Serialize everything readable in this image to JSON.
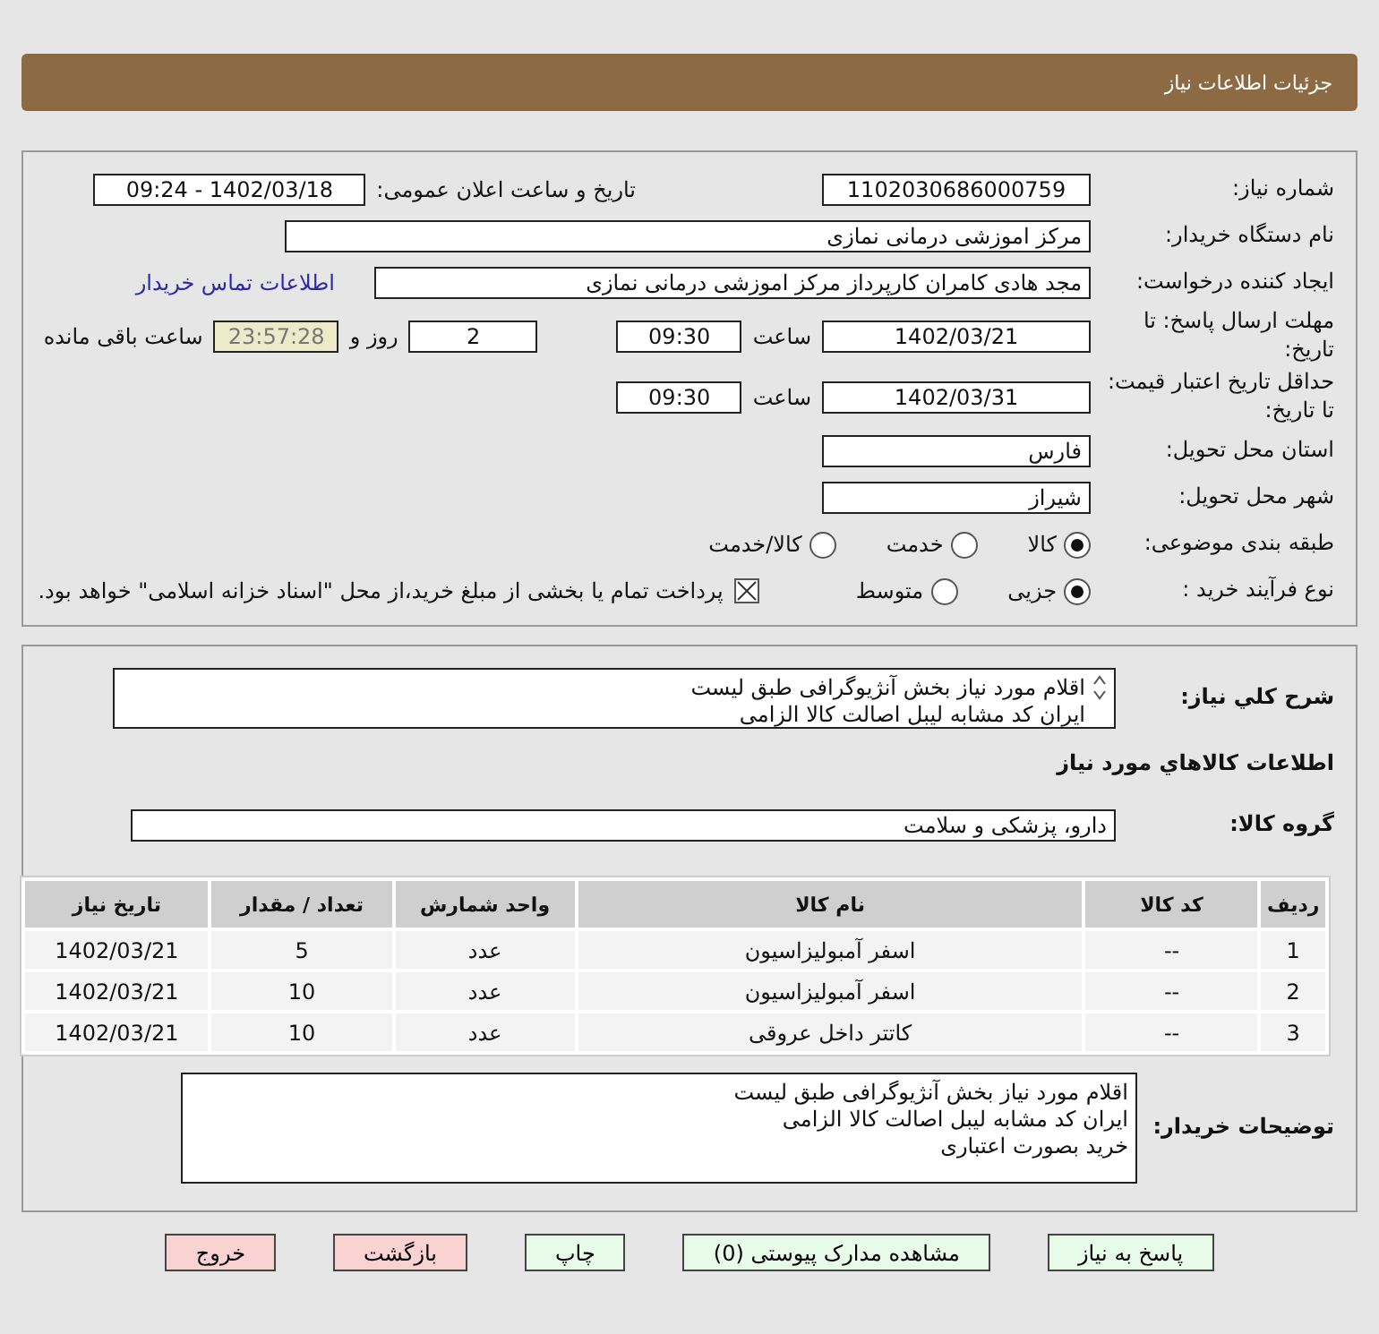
{
  "header": {
    "title": "جزئیات اطلاعات نیاز"
  },
  "details": {
    "need_number": {
      "label": "شماره نیاز:",
      "value": "1102030686000759"
    },
    "announce": {
      "label": "تاریخ و ساعت اعلان عمومی:",
      "value": "1402/03/18 - 09:24"
    },
    "buyer_org": {
      "label": "نام دستگاه خریدار:",
      "value": "مرکز اموزشی درمانی نمازی"
    },
    "requester": {
      "label": "ایجاد کننده درخواست:",
      "value": "مجد هادی کامران کارپرداز مرکز اموزشی درمانی نمازی",
      "link": "اطلاعات تماس خریدار"
    },
    "deadline": {
      "label": "مهلت ارسال پاسخ: تا تاریخ:",
      "date": "1402/03/21",
      "time_label": "ساعت",
      "time": "09:30",
      "days": "2",
      "days_label": "روز و",
      "remaining": "23:57:28",
      "remaining_label": "ساعت باقی مانده"
    },
    "validity": {
      "label": "حداقل تاریخ اعتبار قیمت: تا تاریخ:",
      "date": "1402/03/31",
      "time_label": "ساعت",
      "time": "09:30"
    },
    "province": {
      "label": "استان محل تحویل:",
      "value": "فارس"
    },
    "city": {
      "label": "شهر محل تحویل:",
      "value": "شیراز"
    },
    "category": {
      "label": "طبقه بندی موضوعی:",
      "options": [
        {
          "label": "کالا",
          "selected": true
        },
        {
          "label": "خدمت",
          "selected": false
        },
        {
          "label": "کالا/خدمت",
          "selected": false
        }
      ]
    },
    "process": {
      "label": "نوع فرآیند خرید :",
      "options": [
        {
          "label": "جزیی",
          "selected": true
        },
        {
          "label": "متوسط",
          "selected": false
        }
      ],
      "payment": {
        "checked": true,
        "label": "پرداخت تمام یا بخشی از مبلغ خرید،از محل \"اسناد خزانه اسلامی\" خواهد بود."
      }
    }
  },
  "needs": {
    "summary": {
      "label": "شرح کلي نیاز:",
      "lines": [
        "اقلام مورد نیاز بخش آنژیوگرافی طبق لیست",
        "ایران کد مشابه لیبل اصالت کالا الزامی"
      ]
    },
    "goods_title": "اطلاعات کالاهاي مورد نیاز",
    "group": {
      "label": "گروه کالا:",
      "value": "دارو، پزشکی و سلامت"
    },
    "table": {
      "columns": [
        "ردیف",
        "کد کالا",
        "نام کالا",
        "واحد شمارش",
        "تعداد / مقدار",
        "تاریخ نیاز"
      ],
      "rows": [
        [
          "1",
          "--",
          "اسفر آمبولیزاسیون",
          "عدد",
          "5",
          "1402/03/21"
        ],
        [
          "2",
          "--",
          "اسفر آمبولیزاسیون",
          "عدد",
          "10",
          "1402/03/21"
        ],
        [
          "3",
          "--",
          "کاتتر داخل عروقی",
          "عدد",
          "10",
          "1402/03/21"
        ]
      ]
    },
    "notes": {
      "label": "توضیحات خریدار:",
      "lines": [
        "اقلام مورد نیاز بخش آنژیوگرافی طبق لیست",
        "ایران کد مشابه لیبل اصالت کالا الزامی",
        "خرید بصورت اعتباری"
      ]
    }
  },
  "buttons": [
    {
      "label": "پاسخ به نیاز",
      "kind": "normal"
    },
    {
      "label": "مشاهده مدارک پیوستی (0)",
      "kind": "normal"
    },
    {
      "label": "چاپ",
      "kind": "normal"
    },
    {
      "label": "بازگشت",
      "kind": "danger"
    },
    {
      "label": "خروج",
      "kind": "danger"
    }
  ]
}
